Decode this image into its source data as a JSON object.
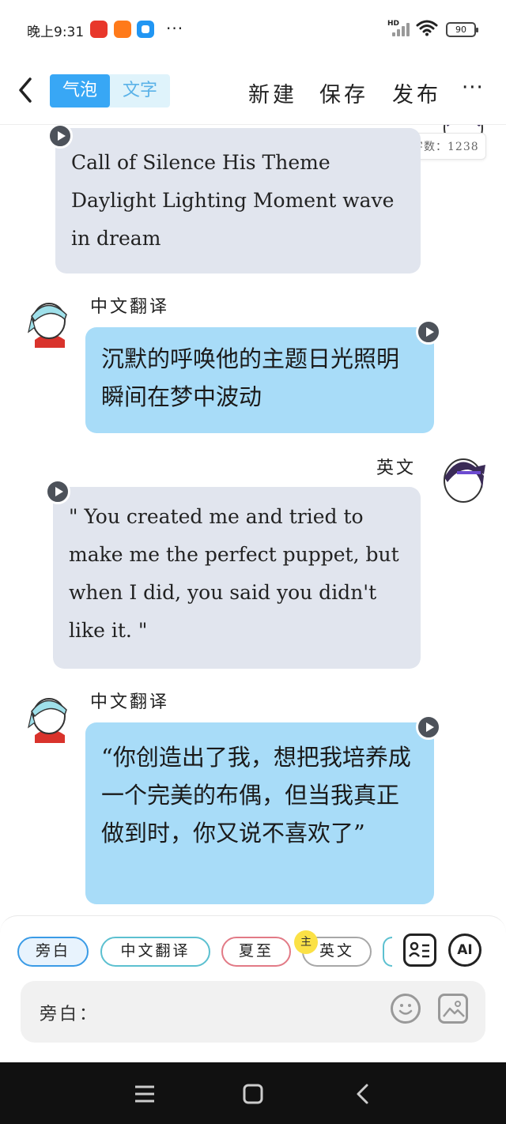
{
  "status_bar": {
    "time": "晚上9:31",
    "more": "···",
    "network": "HD",
    "battery": "90"
  },
  "top_nav": {
    "segments": [
      {
        "label": "气泡",
        "active": true
      },
      {
        "label": "文字",
        "active": false
      }
    ],
    "actions": {
      "new": "新建",
      "save": "保存",
      "publish": "发布",
      "more": "···"
    }
  },
  "word_count": "字数：1238",
  "messages": [
    {
      "speaker": "",
      "side": "right",
      "style": "gray",
      "text": "Call of Silence His Theme Daylight Lighting Moment wave in dream"
    },
    {
      "speaker": "中文翻译",
      "side": "left",
      "style": "blue",
      "text": "沉默的呼唤他的主题日光照明瞬间在梦中波动"
    },
    {
      "speaker": "英文",
      "side": "right",
      "style": "gray",
      "text": "\" You created me and tried to make me the perfect puppet, but when I did, you said you didn't like it. \""
    },
    {
      "speaker": "中文翻译",
      "side": "left",
      "style": "blue",
      "text": "“你创造出了我，想把我培养成一个完美的布偶，但当我真正做到时，你又说不喜欢了”"
    }
  ],
  "characters": {
    "chips": [
      "旁白",
      "中文翻译",
      "夏至",
      "英文"
    ],
    "main_badge": "主"
  },
  "input": {
    "label": "旁白：",
    "ai_label": "AI"
  },
  "colors": {
    "accent": "#38a7f5",
    "bubble_blue": "#a8dcf8",
    "bubble_gray": "#e1e5ee"
  }
}
